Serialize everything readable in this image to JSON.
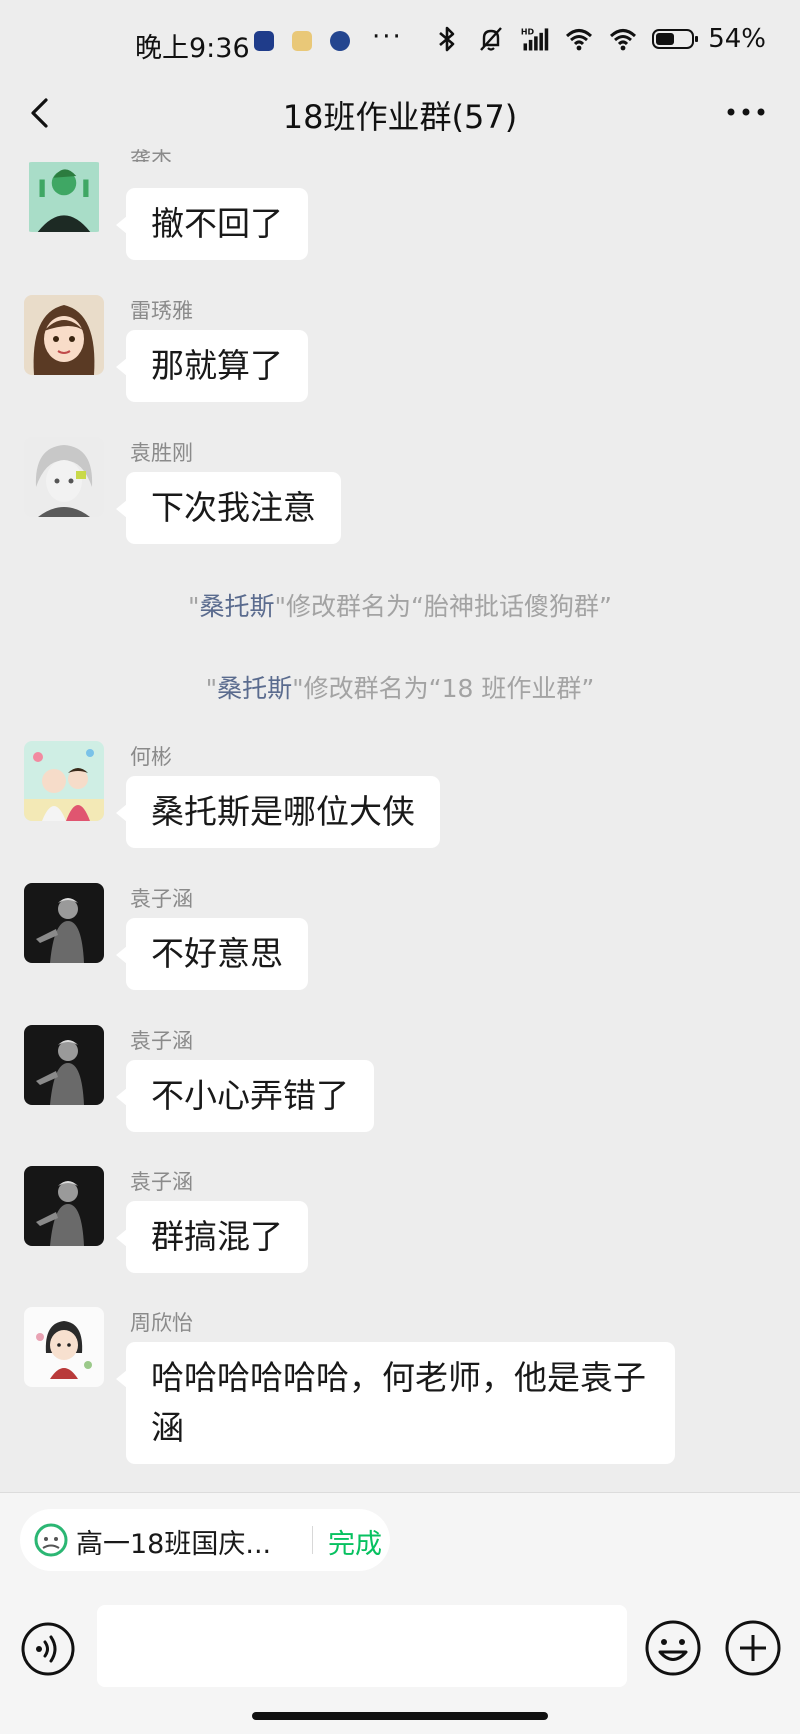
{
  "status_bar": {
    "time": "晚上9:36",
    "dots": "···",
    "battery_pct": "54%",
    "battery_level": 0.54,
    "icons": [
      "bluetooth-icon",
      "bell-muted-icon",
      "hd-signal-icon",
      "wifi-icon",
      "wifi-alt-icon",
      "battery-icon"
    ]
  },
  "nav": {
    "title": "18班作业群(57)"
  },
  "messages": [
    {
      "sender": "龚杰",
      "text": "撤不回了"
    },
    {
      "sender": "雷琇雅",
      "text": "那就算了"
    },
    {
      "sender": "袁胜刚",
      "text": "下次我注意"
    },
    {
      "sender": "何彬",
      "text": "桑托斯是哪位大侠"
    },
    {
      "sender": "袁子涵",
      "text": "不好意思"
    },
    {
      "sender": "袁子涵",
      "text": "不小心弄错了"
    },
    {
      "sender": "袁子涵",
      "text": "群搞混了"
    },
    {
      "sender": "周欣怡",
      "text": "哈哈哈哈哈哈，何老师，他是袁子涵"
    }
  ],
  "system_messages": [
    {
      "quote_open": "\"",
      "nick": "桑托斯",
      "quote_close": "\"",
      "text": "修改群名为“胎神批话傻狗群”"
    },
    {
      "quote_open": "\"",
      "nick": "桑托斯",
      "quote_close": "\"",
      "text": "修改群名为“18 班作业群”"
    }
  ],
  "pinned_task": {
    "title": "高一18班国庆...",
    "status": "完成"
  },
  "colors": {
    "background": "#ededed",
    "bubble": "#ffffff",
    "accent_green": "#07c160",
    "nick_blue": "#5a6b8e"
  }
}
